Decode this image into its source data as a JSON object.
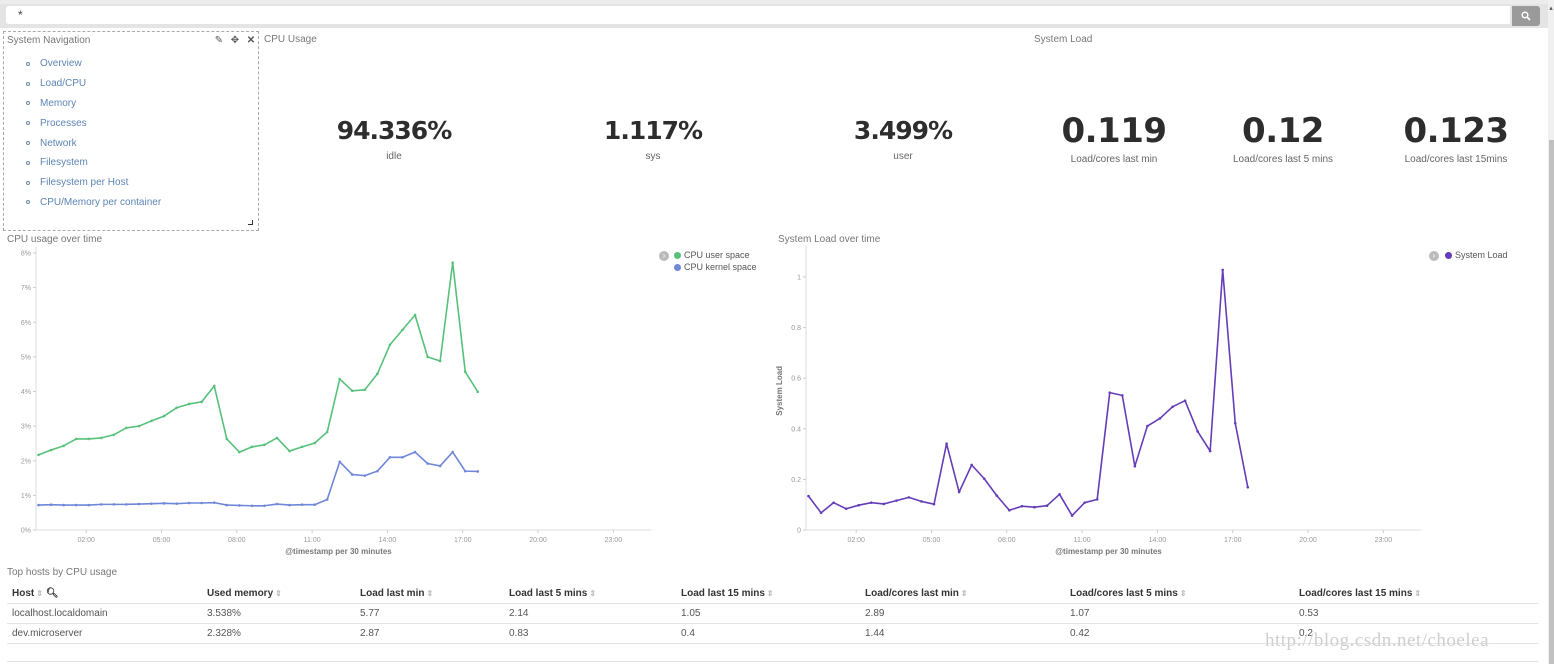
{
  "query": {
    "value": "*",
    "search_icon": "search-icon"
  },
  "nav_panel": {
    "title": "System Navigation",
    "tools": {
      "edit_icon": "pencil-icon",
      "move_icon": "move-icon",
      "close_icon": "close-icon"
    },
    "items": [
      {
        "label": "Overview"
      },
      {
        "label": "Load/CPU"
      },
      {
        "label": "Memory"
      },
      {
        "label": "Processes"
      },
      {
        "label": "Network"
      },
      {
        "label": "Filesystem"
      },
      {
        "label": "Filesystem per Host"
      },
      {
        "label": "CPU/Memory per container"
      }
    ]
  },
  "cpu_usage": {
    "title": "CPU Usage",
    "metrics": [
      {
        "value": "94.336%",
        "label": "idle"
      },
      {
        "value": "1.117%",
        "label": "sys"
      },
      {
        "value": "3.499%",
        "label": "user"
      }
    ]
  },
  "system_load": {
    "title": "System Load",
    "metrics": [
      {
        "value": "0.119",
        "label": "Load/cores last min"
      },
      {
        "value": "0.12",
        "label": "Load/cores last 5 mins"
      },
      {
        "value": "0.123",
        "label": "Load/cores last 15mins"
      }
    ]
  },
  "colors": {
    "cpu_user": "#57c17b",
    "cpu_kernel": "#6f87d8",
    "system_load": "#663db8"
  },
  "chart_data": [
    {
      "type": "line",
      "title": "CPU usage over time",
      "xlabel": "@timestamp per 30 minutes",
      "ylabel": "",
      "ylim": [
        0,
        8
      ],
      "yticks": [
        "0%",
        "1%",
        "2%",
        "3%",
        "4%",
        "5%",
        "6%",
        "7%",
        "8%"
      ],
      "xlim_hours": [
        0,
        24.5
      ],
      "xticks": [
        {
          "label": "02:00",
          "hour": 2
        },
        {
          "label": "05:00",
          "hour": 5
        },
        {
          "label": "08:00",
          "hour": 8
        },
        {
          "label": "11:00",
          "hour": 11
        },
        {
          "label": "14:00",
          "hour": 14
        },
        {
          "label": "17:00",
          "hour": 17
        },
        {
          "label": "20:00",
          "hour": 20
        },
        {
          "label": "23:00",
          "hour": 23
        }
      ],
      "x_start_hour": 0.1,
      "x_step_hours": 0.5,
      "legend": "top-right",
      "series": [
        {
          "name": "CPU user space",
          "color": "#57c17b",
          "values": [
            2.17,
            2.31,
            2.43,
            2.63,
            2.63,
            2.66,
            2.75,
            2.95,
            3.0,
            3.15,
            3.29,
            3.53,
            3.64,
            3.7,
            4.16,
            2.63,
            2.25,
            2.4,
            2.46,
            2.66,
            2.28,
            2.4,
            2.51,
            2.83,
            4.36,
            4.02,
            4.05,
            4.51,
            5.35,
            5.78,
            6.21,
            5.0,
            4.88,
            7.72,
            4.57,
            3.99
          ]
        },
        {
          "name": "CPU kernel space",
          "color": "#6f87d8",
          "values": [
            0.72,
            0.73,
            0.72,
            0.72,
            0.72,
            0.74,
            0.74,
            0.74,
            0.75,
            0.76,
            0.77,
            0.76,
            0.78,
            0.78,
            0.79,
            0.72,
            0.71,
            0.7,
            0.7,
            0.75,
            0.72,
            0.73,
            0.73,
            0.88,
            1.97,
            1.6,
            1.57,
            1.7,
            2.1,
            2.1,
            2.25,
            1.92,
            1.85,
            2.25,
            1.7,
            1.69
          ]
        }
      ]
    },
    {
      "type": "line",
      "title": "System Load over time",
      "xlabel": "@timestamp per 30 minutes",
      "ylabel": "System Load",
      "ylim": [
        0,
        1.1
      ],
      "yticks": [
        "0",
        "0.2",
        "0.4",
        "0.6",
        "0.8",
        "1"
      ],
      "ytick_values": [
        0,
        0.2,
        0.4,
        0.6,
        0.8,
        1
      ],
      "xlim_hours": [
        0,
        24.5
      ],
      "xticks": [
        {
          "label": "02:00",
          "hour": 2
        },
        {
          "label": "05:00",
          "hour": 5
        },
        {
          "label": "08:00",
          "hour": 8
        },
        {
          "label": "11:00",
          "hour": 11
        },
        {
          "label": "14:00",
          "hour": 14
        },
        {
          "label": "17:00",
          "hour": 17
        },
        {
          "label": "20:00",
          "hour": 20
        },
        {
          "label": "23:00",
          "hour": 23
        }
      ],
      "x_start_hour": 0.1,
      "x_step_hours": 0.5,
      "legend": "top-right",
      "series": [
        {
          "name": "System Load",
          "color": "#663db8",
          "values": [
            0.134,
            0.068,
            0.108,
            0.084,
            0.098,
            0.108,
            0.103,
            0.116,
            0.129,
            0.113,
            0.102,
            0.341,
            0.15,
            0.257,
            0.203,
            0.136,
            0.078,
            0.094,
            0.09,
            0.096,
            0.141,
            0.057,
            0.108,
            0.121,
            0.543,
            0.532,
            0.252,
            0.411,
            0.441,
            0.487,
            0.511,
            0.39,
            0.312,
            1.028,
            0.422,
            0.169
          ]
        }
      ]
    }
  ],
  "hosts_table": {
    "title": "Top hosts by CPU usage",
    "columns": [
      "Host",
      "Used memory",
      "Load last min",
      "Load last 5 mins",
      "Load last 15 mins",
      "Load/cores last min",
      "Load/cores last 5 mins",
      "Load/cores last 15 mins"
    ],
    "rows": [
      [
        "localhost.localdomain",
        "3.538%",
        "5.77",
        "2.14",
        "1.05",
        "2.89",
        "1.07",
        "0.53"
      ],
      [
        "dev.microserver",
        "2.328%",
        "2.87",
        "0.83",
        "0.4",
        "1.44",
        "0.42",
        "0.2"
      ]
    ]
  },
  "watermark": "http://blog.csdn.net/choelea"
}
